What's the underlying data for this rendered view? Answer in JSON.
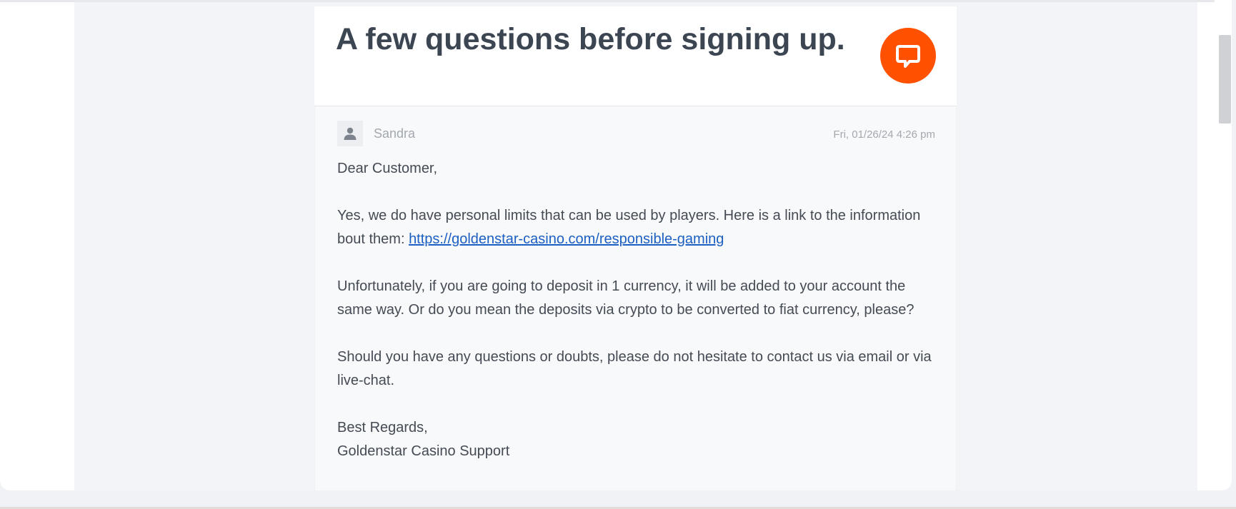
{
  "ticket": {
    "title": "A few questions before signing up."
  },
  "chat_badge": {
    "icon": "chat-bubble-icon",
    "color": "#ff5100"
  },
  "message": {
    "avatar_icon": "user-icon",
    "author": "Sandra",
    "timestamp": "Fri, 01/26/24 4:26 pm",
    "greeting": "Dear Customer,",
    "para1_text": "Yes, we do have personal limits that can be used by players. Here is a link to the information bout them: ",
    "para1_link": "https://goldenstar-casino.com/responsible-gaming",
    "para2": "Unfortunately, if you are going to deposit in 1 currency, it will be added to your account the same way. Or do you mean the deposits via crypto to be converted to fiat currency, please?",
    "para3": "Should you have any questions or doubts, please do not hesitate to contact us via email or via live-chat.",
    "signoff": "Best Regards,",
    "signature": "Goldenstar Casino Support"
  },
  "colors": {
    "title": "#3c4552",
    "body_text": "#454b54",
    "link": "#1c5fc2",
    "muted": "#a3a8af"
  }
}
